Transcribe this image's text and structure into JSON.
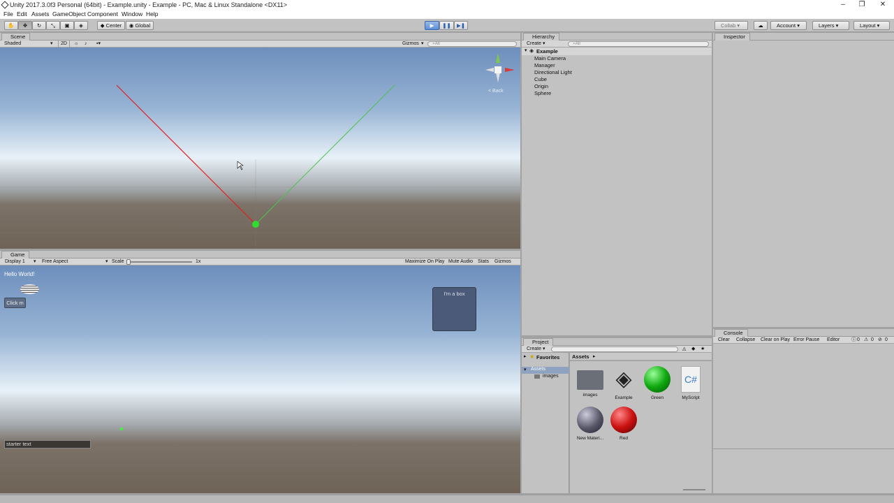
{
  "window": {
    "title": "Unity 2017.3.0f3 Personal (64bit) - Example.unity - Example - PC, Mac & Linux Standalone <DX11>",
    "min": "–",
    "max": "❐",
    "close": "✕"
  },
  "menu": [
    "File",
    "Edit",
    "Assets",
    "GameObject",
    "Component",
    "Window",
    "Help"
  ],
  "toolbar": {
    "center": "Center",
    "global": "Global",
    "collab": "Collab ▾",
    "account": "Account",
    "layers": "Layers",
    "layout": "Layout"
  },
  "scene": {
    "tab": "Scene",
    "shading": "Shaded",
    "mode2d": "2D",
    "gizmos": "Gizmos",
    "search_placeholder": "All",
    "persp": "< Back"
  },
  "game": {
    "tab": "Game",
    "display": "Display 1",
    "aspect": "Free Aspect",
    "scale_label": "Scale",
    "scale_value": "1x",
    "maximize": "Maximize On Play",
    "mute": "Mute Audio",
    "stats": "Stats",
    "gizmos": "Gizmos",
    "hello": "Hello World!",
    "button": "Click m",
    "box": "I'm a box",
    "input": "starter text"
  },
  "hierarchy": {
    "tab": "Hierarchy",
    "create": "Create",
    "search_placeholder": "All",
    "scene": "Example",
    "items": [
      "Main Camera",
      "Manager",
      "Directional Light",
      "Cube",
      "Origin",
      "Sphere"
    ]
  },
  "inspector": {
    "tab": "Inspector"
  },
  "project": {
    "tab": "Project",
    "create": "Create",
    "favorites": "Favorites",
    "breadcrumb": "Assets",
    "tree": [
      "Assets",
      "images"
    ],
    "assets": [
      {
        "name": "images",
        "kind": "folder"
      },
      {
        "name": "Example",
        "kind": "unity"
      },
      {
        "name": "Green",
        "kind": "green"
      },
      {
        "name": "MyScript",
        "kind": "script"
      },
      {
        "name": "New Materi...",
        "kind": "material"
      },
      {
        "name": "Red",
        "kind": "red"
      }
    ]
  },
  "console": {
    "tab": "Console",
    "clear": "Clear",
    "collapse": "Collapse",
    "clear_on_play": "Clear on Play",
    "error_pause": "Error Pause",
    "editor": "Editor",
    "c1": "0",
    "c2": "0",
    "c3": "0"
  }
}
